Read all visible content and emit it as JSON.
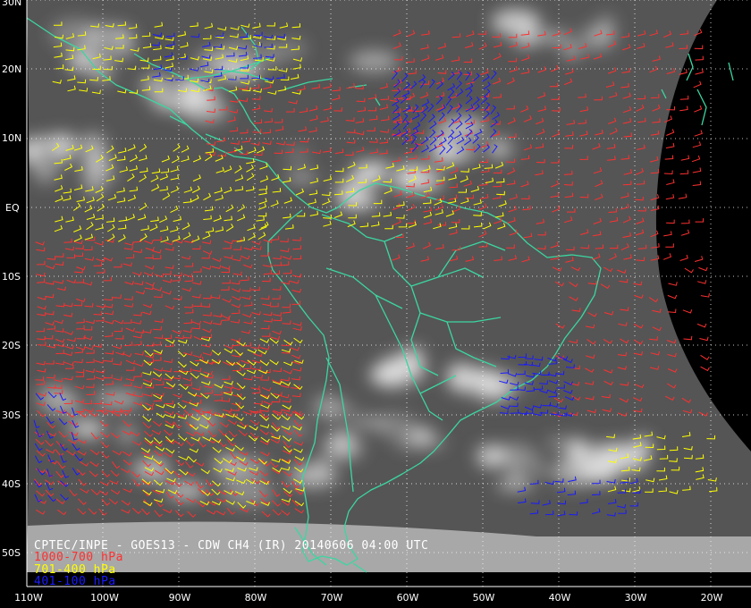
{
  "title": "CPTEC/INPE - GOES13 - CDW CH4 (IR) 20140606 04:00 UTC",
  "legend": [
    {
      "label": "1000-700 hPa",
      "color": "#ff3030"
    },
    {
      "label": "701-400 hPa",
      "color": "#ffff00"
    },
    {
      "label": "401-100 hPa",
      "color": "#1a1aff"
    }
  ],
  "lat_labels": [
    "30N",
    "20N",
    "10N",
    "EQ",
    "10S",
    "20S",
    "30S",
    "40S",
    "50S"
  ],
  "lon_labels": [
    "110W",
    "100W",
    "90W",
    "80W",
    "70W",
    "60W",
    "50W",
    "40W",
    "30W",
    "20W"
  ],
  "colors": {
    "coastline": "#3cd6a0",
    "grid": "#ffffff",
    "space": "#000000",
    "earth": "#5a5a5a",
    "clouds": "#e8e8e8"
  }
}
